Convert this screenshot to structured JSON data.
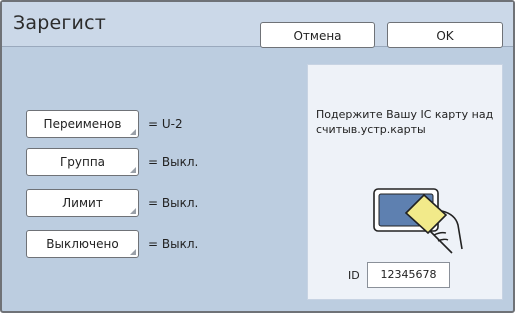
{
  "header": {
    "title": "Зарегист",
    "cancel_label": "Отмена",
    "ok_label": "OK"
  },
  "settings": [
    {
      "button": "Переименов",
      "value": "= U-2"
    },
    {
      "button": "Группа",
      "value": "= Выкл."
    },
    {
      "button": "Лимит",
      "value": "= Выкл."
    },
    {
      "button": "Выключено",
      "value": "= Выкл."
    }
  ],
  "card_panel": {
    "instruction": "Подержите Вашу IC карту над считыв.устр.карты",
    "id_label": "ID",
    "id_value": "12345678",
    "icon": "card-reader-icon"
  },
  "colors": {
    "background": "#bccde0",
    "header": "#cbd8e8",
    "panel": "#eef2f8",
    "reader_screen": "#5e80b0",
    "card": "#f2ea8a"
  }
}
